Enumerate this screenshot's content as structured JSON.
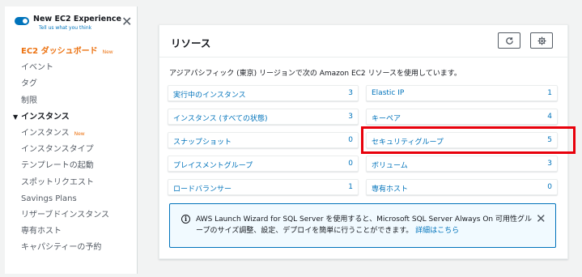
{
  "toggle": {
    "title": "New EC2 Experience",
    "subtitle": "Tell us what you think",
    "close_glyph": "✕"
  },
  "nav": {
    "items": [
      {
        "label": "EC2 ダッシュボード",
        "badge": "New"
      },
      {
        "label": "イベント"
      },
      {
        "label": "タグ"
      },
      {
        "label": "制限"
      },
      {
        "label": "インスタンス",
        "caret": "▼"
      },
      {
        "label": "インスタンス",
        "badge": "New"
      },
      {
        "label": "インスタンスタイプ"
      },
      {
        "label": "テンプレートの起動"
      },
      {
        "label": "スポットリクエスト"
      },
      {
        "label": "Savings Plans"
      },
      {
        "label": "リザーブドインスタンス"
      },
      {
        "label": "専有ホスト"
      },
      {
        "label": "キャパシティーの予約"
      }
    ]
  },
  "panel": {
    "title": "リソース",
    "description": "アジアパシフィック (東京) リージョンで次の Amazon EC2 リソースを使用しています。"
  },
  "resources": {
    "left": [
      {
        "label": "実行中のインスタンス",
        "count": "3"
      },
      {
        "label": "インスタンス (すべての状態)",
        "count": "3"
      },
      {
        "label": "スナップショット",
        "count": "0"
      },
      {
        "label": "プレイスメントグループ",
        "count": "0"
      },
      {
        "label": "ロードバランサー",
        "count": "1"
      }
    ],
    "right": [
      {
        "label": "Elastic IP",
        "count": "1"
      },
      {
        "label": "キーペア",
        "count": "4"
      },
      {
        "label": "セキュリティグループ",
        "count": "5"
      },
      {
        "label": "ボリューム",
        "count": "3"
      },
      {
        "label": "専有ホスト",
        "count": "0"
      }
    ]
  },
  "info": {
    "text": "AWS Launch Wizard for SQL Server を使用すると、Microsoft SQL Server Always On 可用性グループのサイズ調整、設定、デプロイを簡単に行うことができます。",
    "link": "詳細はこちら",
    "icon_glyph": "i",
    "close_glyph": "✕"
  },
  "colors": {
    "accent": "#0073bb",
    "active_nav": "#ec7211",
    "highlight": "#e8000b"
  }
}
